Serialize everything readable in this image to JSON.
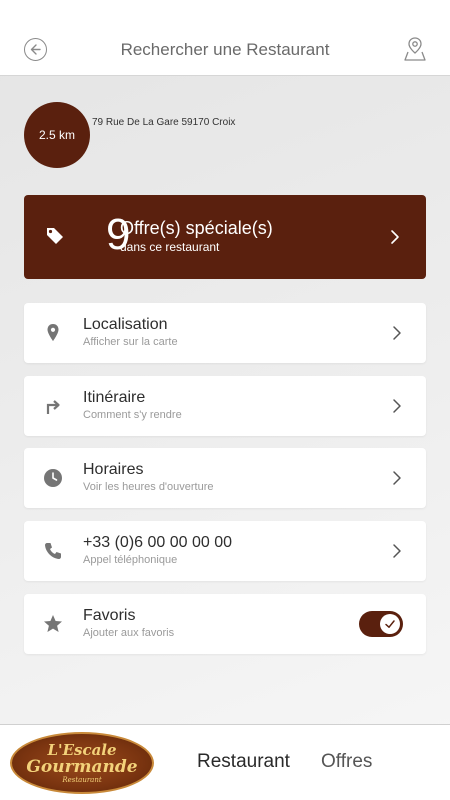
{
  "header": {
    "title": "Rechercher une Restaurant"
  },
  "restaurant": {
    "distance": "2.5 km",
    "address": "79 Rue De La Gare 59170 Croix"
  },
  "offers": {
    "count": "9",
    "title": "Offre(s) spéciale(s)",
    "subtitle": "dans ce restaurant"
  },
  "rows": [
    {
      "label": "Localisation",
      "sub": "Afficher sur la carte",
      "icon": "location-pin-icon"
    },
    {
      "label": "Itinéraire",
      "sub": "Comment s'y rendre",
      "icon": "turn-right-arrow-icon"
    },
    {
      "label": "Horaires",
      "sub": "Voir les heures d'ouverture",
      "icon": "clock-icon"
    },
    {
      "label": "+33 (0)6 00 00 00 00",
      "sub": "Appel téléphonique",
      "icon": "phone-icon"
    },
    {
      "label": "Favoris",
      "sub": "Ajouter aux favoris",
      "icon": "star-icon"
    }
  ],
  "favorite_enabled": true,
  "bottom_nav": {
    "logo_line1": "L'Escale",
    "logo_line2": "Gourmande",
    "logo_line3": "Restaurant",
    "items": [
      "Restaurant",
      "Offres"
    ]
  },
  "colors": {
    "accent": "#5a200e",
    "background": "#ececec"
  }
}
